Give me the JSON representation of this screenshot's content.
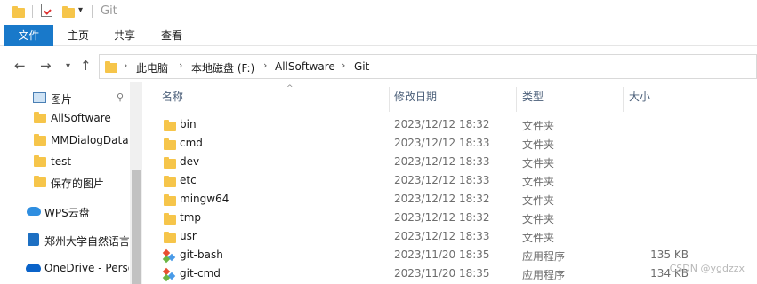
{
  "titlebar": {
    "title": "Git",
    "quick_access_icons": [
      "folder-icon",
      "properties-icon",
      "new-folder-icon"
    ],
    "dropdown_glyph": "▾"
  },
  "ribbon": {
    "tabs": [
      {
        "label": "文件",
        "active": true
      },
      {
        "label": "主页"
      },
      {
        "label": "共享"
      },
      {
        "label": "查看"
      }
    ],
    "file_tab_color": "#1979ca"
  },
  "navigation": {
    "back_glyph": "←",
    "forward_glyph": "→",
    "recent_glyph": "▾",
    "up_glyph": "↑",
    "breadcrumb": [
      "此电脑",
      "本地磁盘 (F:)",
      "AllSoftware",
      "Git"
    ],
    "separator_glyph": "›"
  },
  "sidebar": {
    "items": [
      {
        "label": "图片",
        "icon": "pictures-icon",
        "pinned": true
      },
      {
        "label": "AllSoftware",
        "icon": "folder-icon"
      },
      {
        "label": "MMDialogData",
        "icon": "folder-icon"
      },
      {
        "label": "test",
        "icon": "folder-icon"
      },
      {
        "label": "保存的图片",
        "icon": "folder-icon"
      },
      {
        "label": "WPS云盘",
        "icon": "cloud-icon"
      },
      {
        "label": "郑州大学自然语言",
        "icon": "app-icon"
      },
      {
        "label": "OneDrive - Perso",
        "icon": "onedrive-icon"
      }
    ],
    "pin_glyph": "📌"
  },
  "file_list": {
    "columns": [
      "名称",
      "修改日期",
      "类型",
      "大小"
    ],
    "sort_glyph": "^",
    "rows": [
      {
        "name": "bin",
        "date": "2023/12/12 18:32",
        "type": "文件夹",
        "size": "",
        "icon": "folder-icon"
      },
      {
        "name": "cmd",
        "date": "2023/12/12 18:33",
        "type": "文件夹",
        "size": "",
        "icon": "folder-icon"
      },
      {
        "name": "dev",
        "date": "2023/12/12 18:33",
        "type": "文件夹",
        "size": "",
        "icon": "folder-icon"
      },
      {
        "name": "etc",
        "date": "2023/12/12 18:33",
        "type": "文件夹",
        "size": "",
        "icon": "folder-icon"
      },
      {
        "name": "mingw64",
        "date": "2023/12/12 18:32",
        "type": "文件夹",
        "size": "",
        "icon": "folder-icon"
      },
      {
        "name": "tmp",
        "date": "2023/12/12 18:32",
        "type": "文件夹",
        "size": "",
        "icon": "folder-icon"
      },
      {
        "name": "usr",
        "date": "2023/12/12 18:33",
        "type": "文件夹",
        "size": "",
        "icon": "folder-icon"
      },
      {
        "name": "git-bash",
        "date": "2023/11/20 18:35",
        "type": "应用程序",
        "size": "135 KB",
        "icon": "git-icon"
      },
      {
        "name": "git-cmd",
        "date": "2023/11/20 18:35",
        "type": "应用程序",
        "size": "134 KB",
        "icon": "git-icon"
      }
    ]
  },
  "watermark": "CSDN @ygdzzx"
}
